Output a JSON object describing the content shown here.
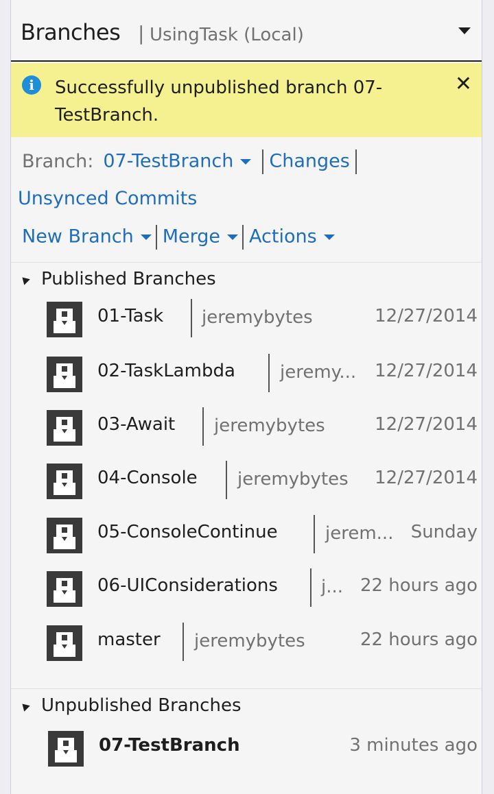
{
  "header": {
    "title": "Branches",
    "separator": "|",
    "subtitle": "UsingTask (Local)"
  },
  "notification": {
    "message": "Successfully unpublished branch 07-TestBranch.",
    "info_icon": "i",
    "close": "✕"
  },
  "toolbar": {
    "branch_label": "Branch:",
    "current_branch": "07-TestBranch",
    "changes": "Changes",
    "unsynced_commits": "Unsynced Commits",
    "new_branch": "New Branch",
    "merge": "Merge",
    "actions": "Actions"
  },
  "published": {
    "heading": "Published Branches",
    "branches": [
      {
        "name": "01-Task",
        "author": "jeremybytes",
        "date": "12/27/2014"
      },
      {
        "name": "02-TaskLambda",
        "author": "jeremy...",
        "date": "12/27/2014"
      },
      {
        "name": "03-Await",
        "author": "jeremybytes",
        "date": "12/27/2014"
      },
      {
        "name": "04-Console",
        "author": "jeremybytes",
        "date": "12/27/2014"
      },
      {
        "name": "05-ConsoleContinue",
        "author": "jerem...",
        "date": "Sunday"
      },
      {
        "name": "06-UIConsiderations",
        "author": "j...",
        "date": "22 hours ago"
      },
      {
        "name": "master",
        "author": "jeremybytes",
        "date": "22 hours ago"
      }
    ]
  },
  "unpublished": {
    "heading": "Unpublished Branches",
    "branches": [
      {
        "name": "07-TestBranch",
        "date": "3 minutes ago"
      }
    ]
  },
  "colors": {
    "link": "#1e6dbf",
    "notification_bg": "#f5f190",
    "info_icon": "#1e8fd6"
  }
}
